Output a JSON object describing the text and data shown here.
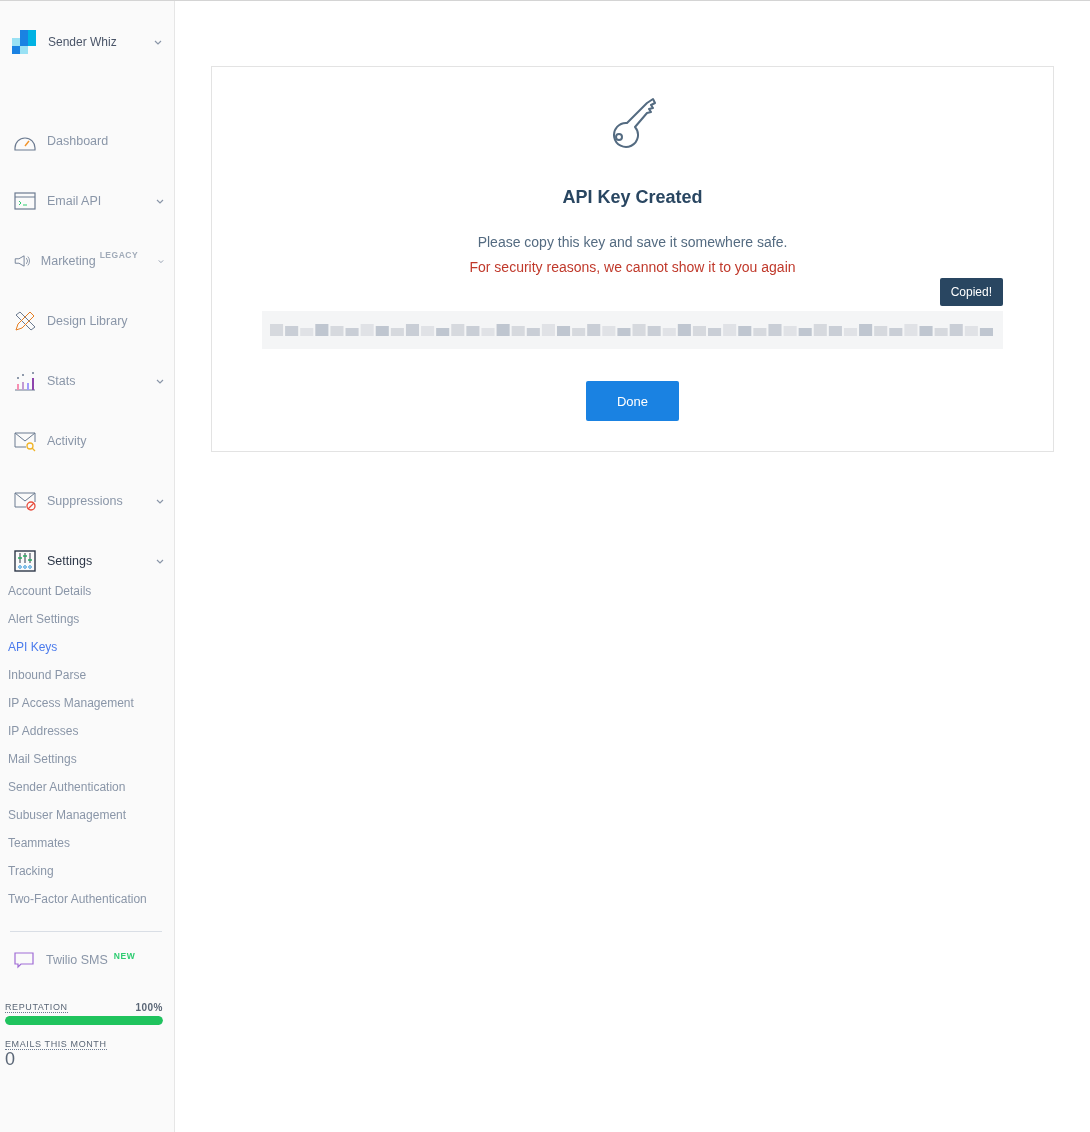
{
  "account": {
    "name": "Sender Whiz"
  },
  "nav": [
    {
      "label": "Dashboard",
      "expandable": false,
      "expanded": false
    },
    {
      "label": "Email API",
      "expandable": true,
      "expanded": false
    },
    {
      "label": "Marketing",
      "badge": "LEGACY",
      "expandable": true,
      "expanded": false
    },
    {
      "label": "Design Library",
      "expandable": false,
      "expanded": false
    },
    {
      "label": "Stats",
      "expandable": true,
      "expanded": false
    },
    {
      "label": "Activity",
      "expandable": false,
      "expanded": false
    },
    {
      "label": "Suppressions",
      "expandable": true,
      "expanded": false
    },
    {
      "label": "Settings",
      "expandable": true,
      "expanded": true,
      "children": [
        {
          "label": "Account Details",
          "selected": false
        },
        {
          "label": "Alert Settings",
          "selected": false
        },
        {
          "label": "API Keys",
          "selected": true
        },
        {
          "label": "Inbound Parse",
          "selected": false
        },
        {
          "label": "IP Access Management",
          "selected": false
        },
        {
          "label": "IP Addresses",
          "selected": false
        },
        {
          "label": "Mail Settings",
          "selected": false
        },
        {
          "label": "Sender Authentication",
          "selected": false
        },
        {
          "label": "Subuser Management",
          "selected": false
        },
        {
          "label": "Teammates",
          "selected": false
        },
        {
          "label": "Tracking",
          "selected": false
        },
        {
          "label": "Two-Factor Authentication",
          "selected": false
        }
      ]
    }
  ],
  "sms": {
    "label": "Twilio SMS",
    "badge": "NEW"
  },
  "reputation": {
    "label": "REPUTATION",
    "value": "100%",
    "level": 1
  },
  "emails": {
    "label": "EMAILS THIS MONTH",
    "value": "0"
  },
  "dialog": {
    "title": "API Key Created",
    "message": "Please copy this key and save it somewhere safe.",
    "warning": "For security reasons, we cannot show it to you again",
    "tooltip": "Copied!",
    "button": "Done"
  }
}
